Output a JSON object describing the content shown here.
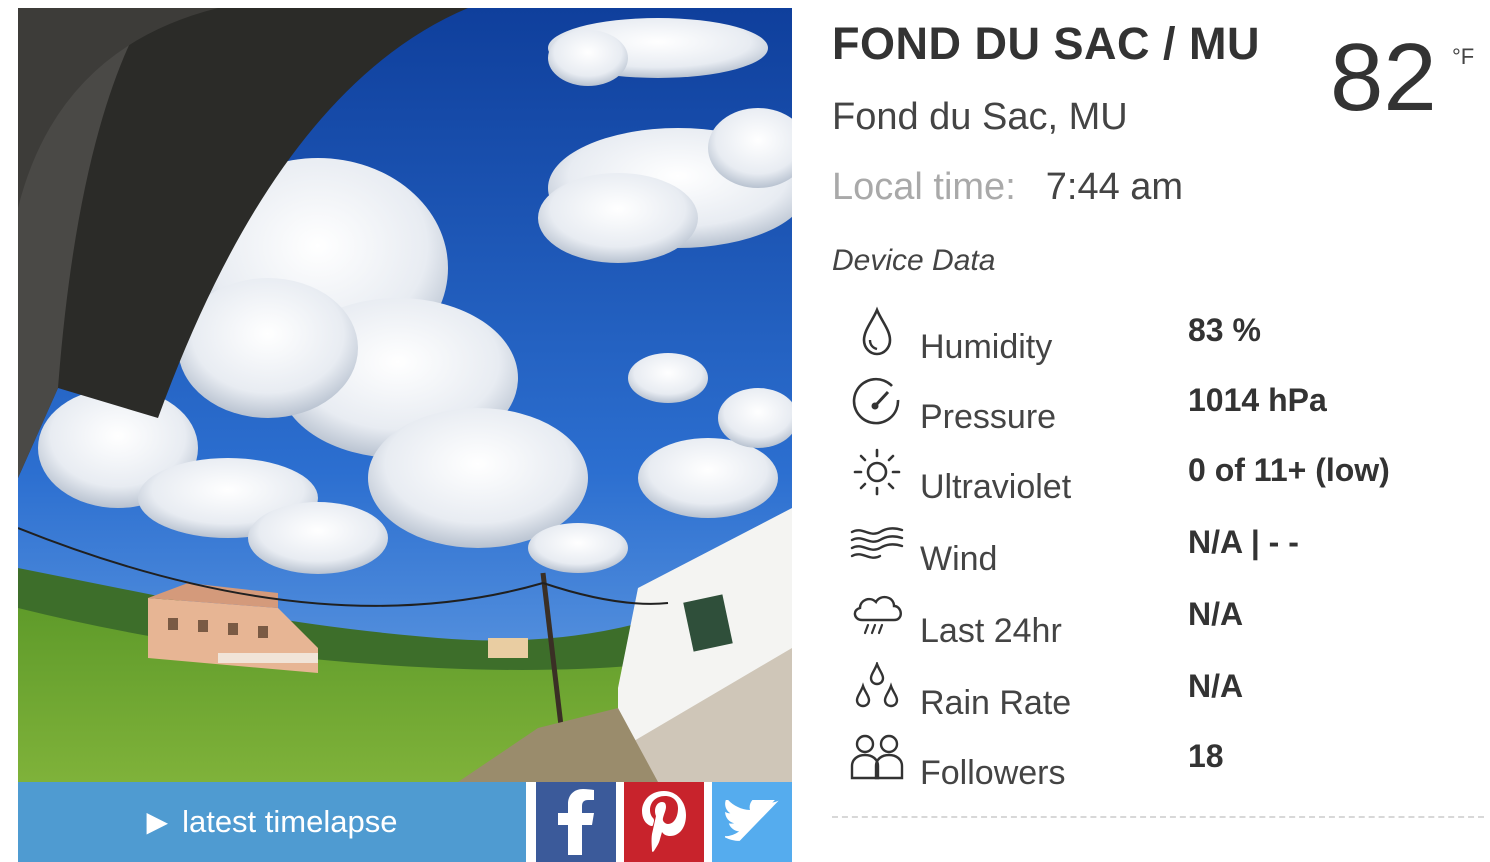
{
  "station": {
    "code": "FOND DU SAC / MU",
    "name": "Fond du Sac, MU",
    "local_time_label": "Local time:",
    "local_time_value": "7:44 am",
    "temperature": "82",
    "temperature_unit": "°F"
  },
  "device_data": {
    "title": "Device Data",
    "rows": [
      {
        "icon": "droplet-icon",
        "label": "Humidity",
        "value": "83 %"
      },
      {
        "icon": "gauge-icon",
        "label": "Pressure",
        "value": "1014 hPa"
      },
      {
        "icon": "sun-icon",
        "label": "Ultraviolet",
        "value": "0 of 11+ (low)"
      },
      {
        "icon": "wind-icon",
        "label": "Wind",
        "value": "N/A | - -"
      },
      {
        "icon": "rain-cloud-icon",
        "label": "Last 24hr",
        "value": "N/A"
      },
      {
        "icon": "raindrops-icon",
        "label": "Rain Rate",
        "value": "N/A"
      },
      {
        "icon": "followers-icon",
        "label": "Followers",
        "value": "18"
      }
    ]
  },
  "actions": {
    "timelapse_label": "latest timelapse",
    "share": [
      {
        "icon": "facebook-icon",
        "color": "#3b5a9a"
      },
      {
        "icon": "pinterest-icon",
        "color": "#c8232c"
      },
      {
        "icon": "twitter-icon",
        "color": "#55acee"
      }
    ]
  },
  "colors": {
    "timelapse_bg": "#4f9bd1",
    "sky": "#1f5fb8"
  }
}
